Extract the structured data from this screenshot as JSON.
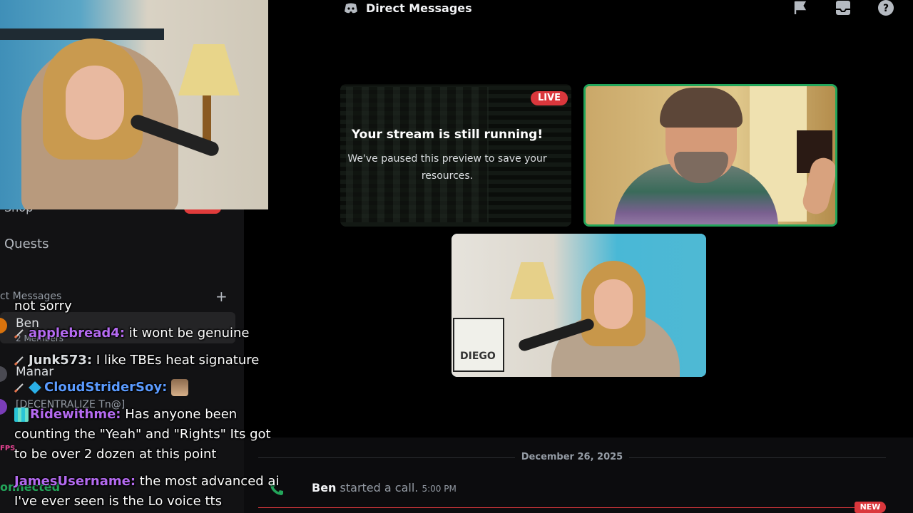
{
  "header": {
    "title": "Direct Messages"
  },
  "sidebar": {
    "shop_label": "Shop",
    "shop_badge": "NEW",
    "quests_label": "Quests",
    "dm_header": "ct Messages",
    "dm_add": "+",
    "dms": [
      {
        "name": "Ben",
        "sub": "2 Members"
      },
      {
        "name": "Manar",
        "sub": ""
      },
      {
        "name": "[DECENTRALIZE Tn@]",
        "sub": ""
      }
    ],
    "fps": "FPS",
    "connection_status": "onnected"
  },
  "call": {
    "live_badge": "LIVE",
    "stream_title": "Your stream is still running!",
    "stream_desc": "We've paused this preview to save your resources.",
    "sign_text": "DIEGO"
  },
  "messages": {
    "date": "December 26, 2025",
    "call_author": "Ben",
    "call_text": "started a call.",
    "call_time": "5:00 PM",
    "new_badge": "NEW"
  },
  "chat": [
    {
      "user": "",
      "text": "not sorry",
      "color": "#ffffff"
    },
    {
      "user": "applebread4:",
      "text": "it wont be genuine",
      "color": "#b46af0"
    },
    {
      "user": "Junk573:",
      "text": "I like TBEs heat signature",
      "color": "#dbdee1"
    },
    {
      "user": "CloudStriderSoy:",
      "text": "",
      "color": "#5b9bff"
    },
    {
      "user": "Ridewithme:",
      "text": "Has anyone been",
      "color": "#b46af0"
    },
    {
      "user": "",
      "text": "counting the \"Yeah\" and \"Rights\" Its got",
      "color": "#ffffff"
    },
    {
      "user": "",
      "text": "to be over 2 dozen at this point",
      "color": "#ffffff"
    },
    {
      "user": "JamesUsername:",
      "text": "the most advanced ai",
      "color": "#b46af0"
    },
    {
      "user": "",
      "text": "I've ever seen is the Lo voice tts",
      "color": "#ffffff"
    }
  ],
  "icons": [
    "discord-icon",
    "flag-icon",
    "inbox-icon",
    "help-icon",
    "phone-icon",
    "sword-badge-icon",
    "cube-badge-icon",
    "emote-icon"
  ],
  "colors": {
    "accent_green": "#23a55a",
    "live_red": "#da373c",
    "username_purple": "#b46af0",
    "username_blue": "#5b9bff"
  }
}
